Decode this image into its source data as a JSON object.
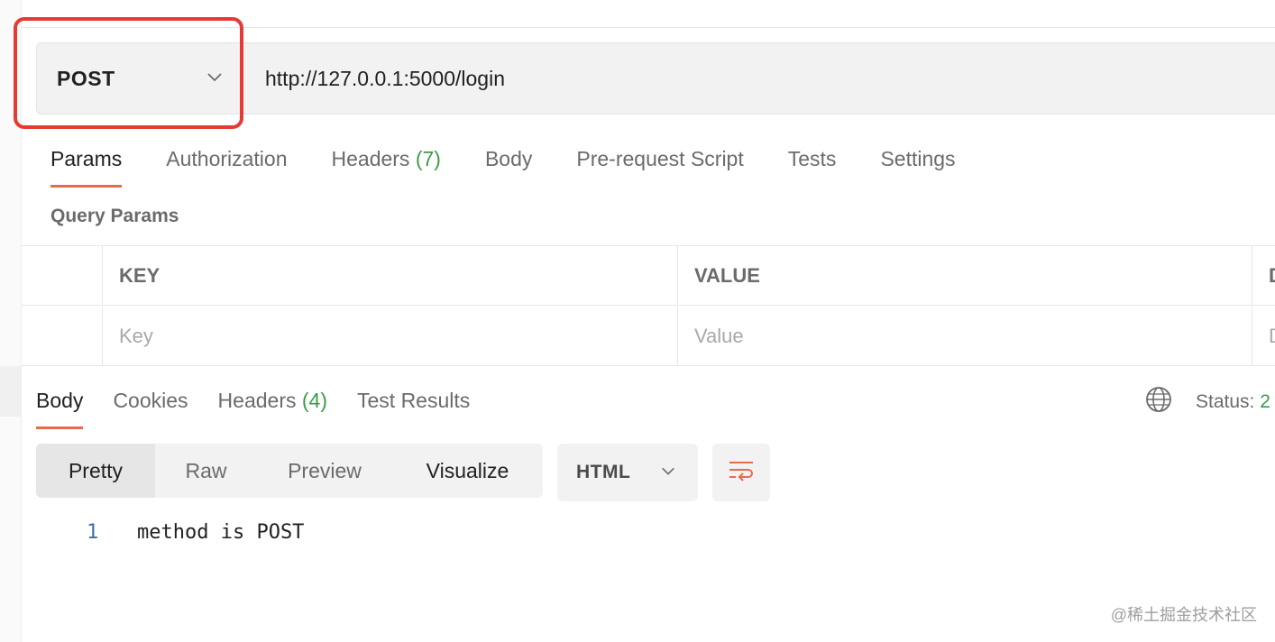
{
  "request": {
    "method": "POST",
    "url": "http://127.0.0.1:5000/login"
  },
  "request_tabs": [
    {
      "label": "Params",
      "count": ""
    },
    {
      "label": "Authorization",
      "count": ""
    },
    {
      "label": "Headers",
      "count": "(7)"
    },
    {
      "label": "Body",
      "count": ""
    },
    {
      "label": "Pre-request Script",
      "count": ""
    },
    {
      "label": "Tests",
      "count": ""
    },
    {
      "label": "Settings",
      "count": ""
    }
  ],
  "query_params": {
    "title": "Query Params",
    "columns": {
      "key": "KEY",
      "value": "VALUE",
      "description": "D"
    },
    "placeholders": {
      "key": "Key",
      "value": "Value",
      "description": "D"
    }
  },
  "response_tabs": [
    {
      "label": "Body",
      "count": ""
    },
    {
      "label": "Cookies",
      "count": ""
    },
    {
      "label": "Headers",
      "count": "(4)"
    },
    {
      "label": "Test Results",
      "count": ""
    }
  ],
  "status": {
    "label": "Status:",
    "value": "2"
  },
  "view_modes": [
    "Pretty",
    "Raw",
    "Preview",
    "Visualize"
  ],
  "format": "HTML",
  "body_lines": [
    {
      "number": "1",
      "text": "method is POST"
    }
  ],
  "watermark": "@稀土掘金技术社区",
  "colors": {
    "highlight_box": "#e53b35",
    "active_tab_underline": "#e56b4b",
    "count_green": "#3d9b4a"
  },
  "icons": {
    "method_dropdown": "chevron-down-icon",
    "globe": "globe-icon",
    "format_dropdown": "chevron-down-icon",
    "wrap": "wrap-lines-icon"
  }
}
